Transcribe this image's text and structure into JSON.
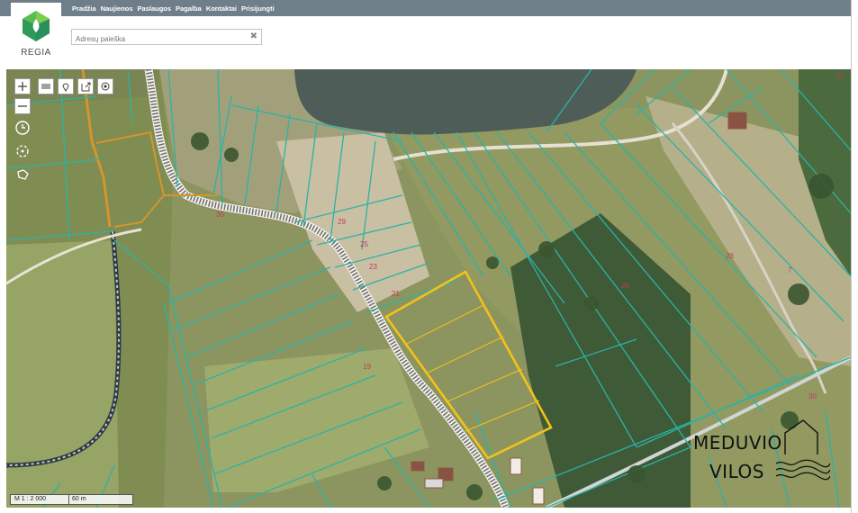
{
  "nav": {
    "items": [
      "Pradžia",
      "Naujienos",
      "Paslaugos",
      "Pagalba",
      "Kontaktai",
      "Prisijungti"
    ]
  },
  "logo": {
    "text": "REGIA"
  },
  "search": {
    "placeholder": "Adresų paieška"
  },
  "map": {
    "parcel_labels": [
      "30",
      "29",
      "25",
      "23",
      "21",
      "19",
      "26",
      "28",
      "30",
      "31",
      "7"
    ],
    "scale_label": "M 1 : 2 000",
    "scale_bar": "60 m",
    "brand_line1": "MEDUVIO",
    "brand_line2": "VILOS",
    "colors": {
      "parcel_line": "#2ab3a6",
      "highlight": "#f3c21a",
      "water": "#4e5d58",
      "road": "#ffffff"
    }
  },
  "tools": [
    "zoom-in-icon",
    "zoom-out-icon",
    "layers-icon",
    "marker-icon",
    "export-icon",
    "locate-icon",
    "history-icon",
    "crosshair-icon",
    "polygon-icon"
  ]
}
